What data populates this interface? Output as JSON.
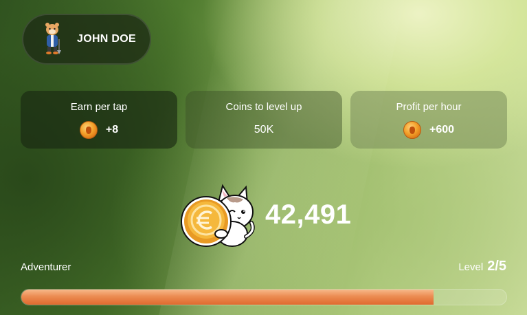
{
  "profile": {
    "name": "JOHN DOE",
    "avatar_icon": "hamster-avatar-icon"
  },
  "stats": [
    {
      "label": "Earn per tap",
      "value": "+8",
      "icon": "coin-icon"
    },
    {
      "label": "Coins to level up",
      "value": "50K"
    },
    {
      "label": "Profit per hour",
      "value": "+600",
      "icon": "coin-icon"
    }
  ],
  "balance": {
    "value": "42,491",
    "icon": "coin-cat-mascot-icon"
  },
  "level": {
    "rank_name": "Adventurer",
    "label": "Level",
    "value": "2/5",
    "progress": 0.85
  },
  "colors": {
    "progress_fill": "#ec8c52",
    "coin": "#f3a12a"
  }
}
